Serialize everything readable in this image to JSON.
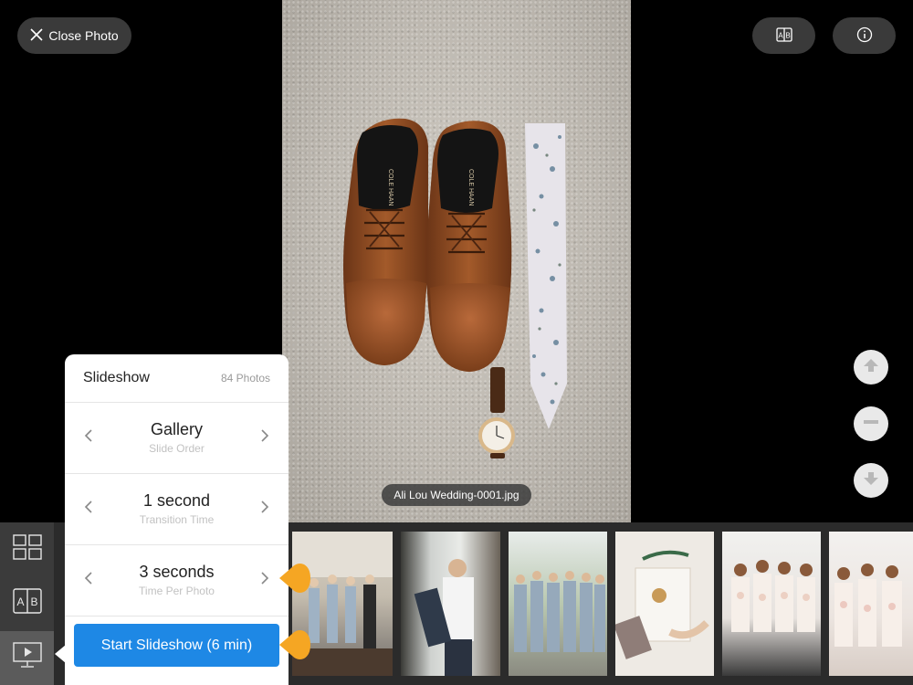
{
  "header": {
    "close_label": "Close Photo"
  },
  "photo": {
    "caption": "Ali Lou Wedding-0001.jpg",
    "shoe_brand": "COLE HAAN"
  },
  "slideshow": {
    "title": "Slideshow",
    "photo_count": "84 Photos",
    "options": [
      {
        "value": "Gallery",
        "label": "Slide Order"
      },
      {
        "value": "1 second",
        "label": "Transition Time"
      },
      {
        "value": "3 seconds",
        "label": "Time Per Photo"
      }
    ],
    "start_label": "Start Slideshow (6 min)"
  },
  "colors": {
    "accent": "#1e88e5",
    "marker": "#f5a623"
  },
  "icons": {
    "close": "close-icon",
    "compare": "compare-ab-icon",
    "info": "info-icon",
    "up": "arrow-up-icon",
    "minus": "minus-icon",
    "down": "arrow-down-icon",
    "grid": "grid-icon",
    "ab": "compare-ab-icon",
    "slideshow": "slideshow-icon"
  }
}
